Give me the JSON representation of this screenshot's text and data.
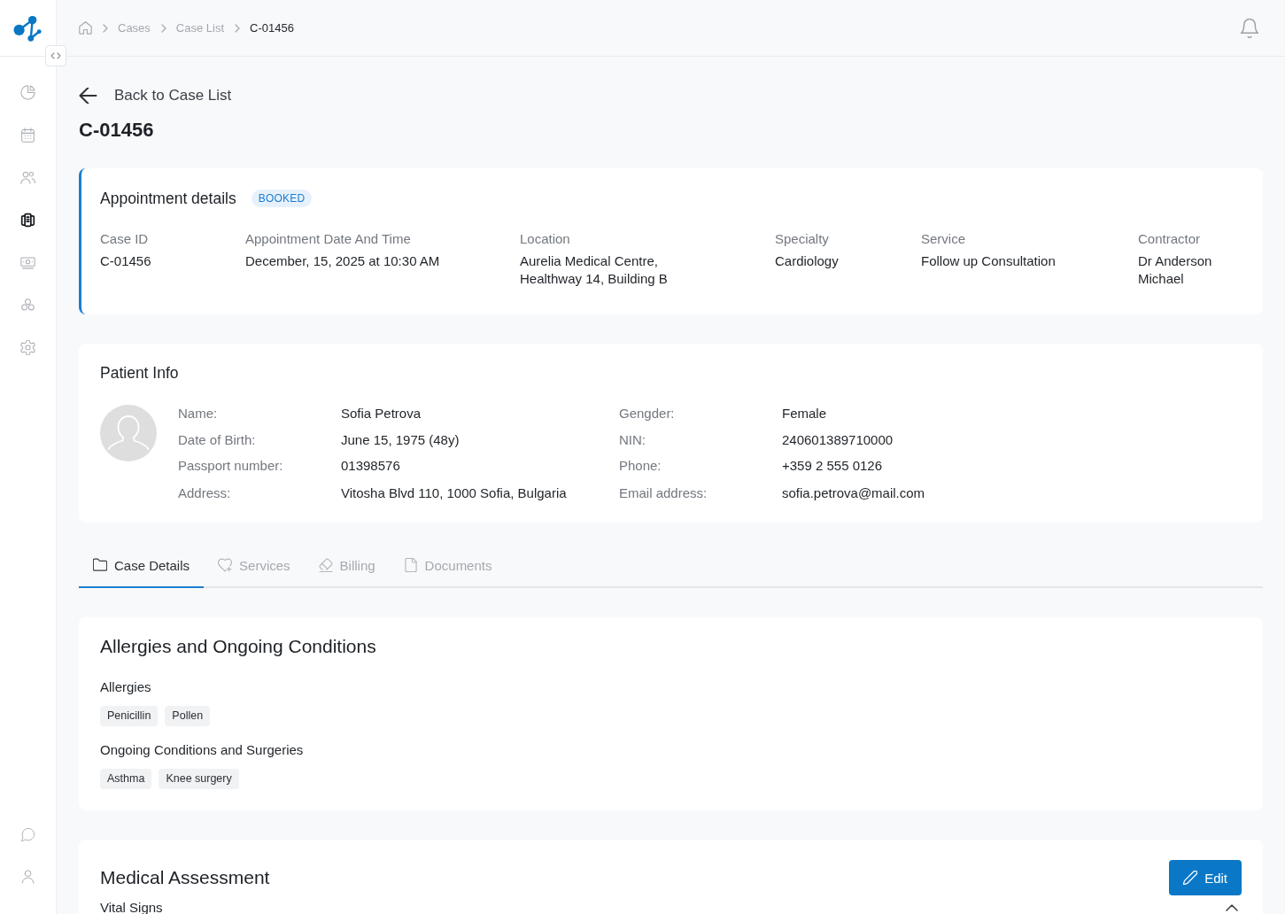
{
  "sidebar": {
    "nav_items": [
      {
        "selected": false
      },
      {
        "selected": false
      },
      {
        "selected": false
      },
      {
        "selected": true
      },
      {
        "selected": false
      },
      {
        "selected": false
      },
      {
        "selected": false
      }
    ]
  },
  "breadcrumb": [
    {
      "label": "Cases",
      "current": false
    },
    {
      "label": "Case List",
      "current": false
    },
    {
      "label": "C-01456",
      "current": true
    }
  ],
  "back_link": "Back to Case List",
  "page_title": "C-01456",
  "appointment": {
    "title": "Appointment details",
    "status": "BOOKED",
    "fields": [
      {
        "label": "Case ID",
        "value": "C-01456"
      },
      {
        "label": "Appointment Date And Time",
        "value": "December, 15, 2025 at 10:30 AM"
      },
      {
        "label": "Location",
        "value": "Aurelia Medical Centre, Healthway 14, Building B"
      },
      {
        "label": "Specialty",
        "value": "Cardiology"
      },
      {
        "label": "Service",
        "value": "Follow up Consultation"
      },
      {
        "label": "Contractor",
        "value": "Dr Anderson Michael"
      }
    ]
  },
  "patient": {
    "title": "Patient Info",
    "columns": [
      {
        "fields": [
          {
            "label": "Name:",
            "value": "Sofia Petrova"
          },
          {
            "label": "Date of Birth:",
            "value": "June 15, 1975 (48y)"
          },
          {
            "label": "Passport number:",
            "value": "01398576"
          },
          {
            "label": "Address:",
            "value": "Vitosha Blvd 110, 1000 Sofia, Bulgaria"
          }
        ]
      },
      {
        "fields": [
          {
            "label": "Gengder:",
            "value": "Female"
          },
          {
            "label": "NIN:",
            "value": "240601389710000"
          },
          {
            "label": "Phone:",
            "value": "+359 2 555 0126"
          },
          {
            "label": "Email address:",
            "value": "sofia.petrova@mail.com"
          }
        ]
      }
    ]
  },
  "tabs": [
    {
      "label": "Case Details",
      "selected": true
    },
    {
      "label": "Services",
      "selected": false
    },
    {
      "label": "Billing",
      "selected": false
    },
    {
      "label": "Documents",
      "selected": false
    }
  ],
  "conditions": {
    "title": "Allergies and Ongoing Conditions",
    "groups": [
      {
        "title": "Allergies",
        "tags": [
          "Penicillin",
          "Pollen"
        ]
      },
      {
        "title": "Ongoing Conditions and Surgeries",
        "tags": [
          "Asthma",
          "Knee surgery"
        ]
      }
    ]
  },
  "assessment": {
    "title": "Medical Assessment",
    "edit_button": "Edit",
    "sections": [
      {
        "title": "Vital Signs",
        "expanded": true
      }
    ]
  }
}
